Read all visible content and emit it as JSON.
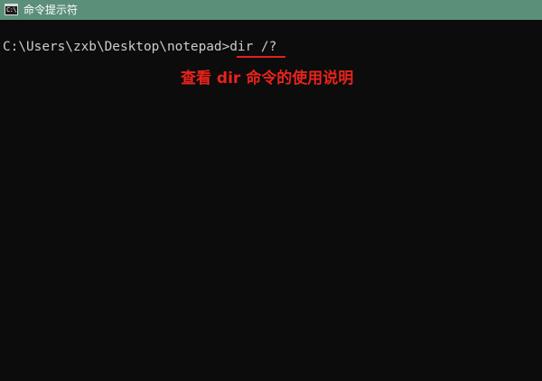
{
  "window": {
    "title": "命令提示符",
    "icon": "cmd-icon",
    "icon_label": "C:\\"
  },
  "console": {
    "prompt": "C:\\Users\\zxb\\Desktop\\notepad>",
    "command": "dir /?"
  },
  "annotation": {
    "text": "查看 dir 命令的使用说明",
    "color": "#e8231b"
  },
  "colors": {
    "titlebar": "#5b8f7a",
    "console_bg": "#0c0c0c",
    "console_text": "#cccccc"
  }
}
